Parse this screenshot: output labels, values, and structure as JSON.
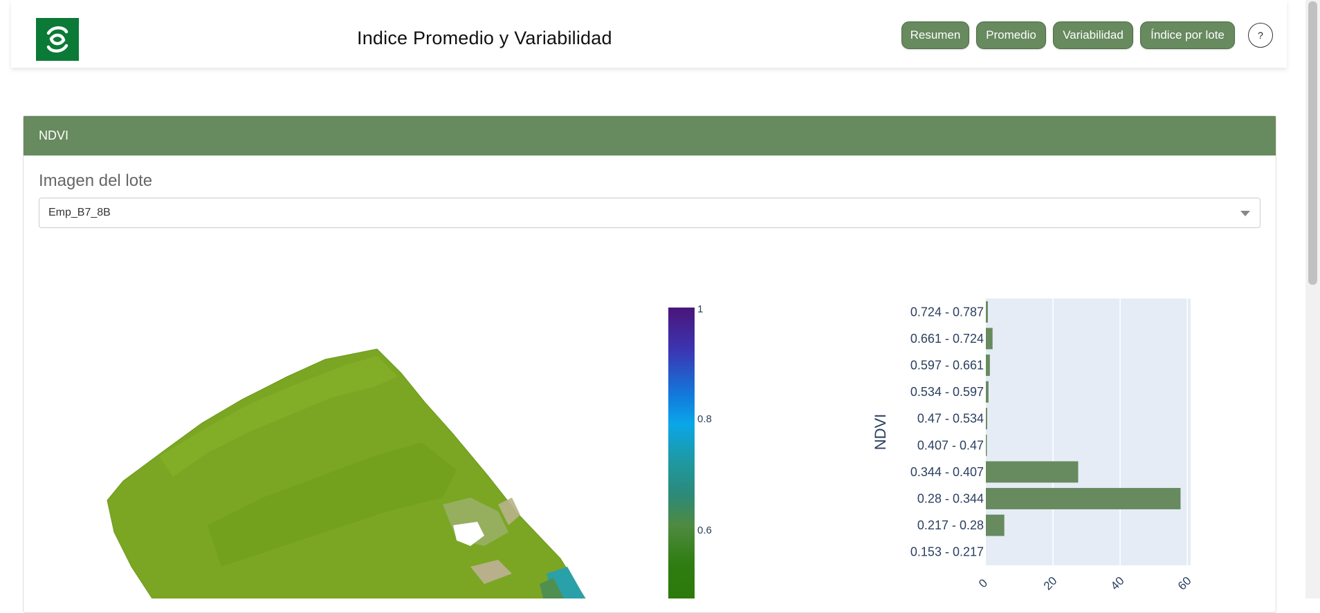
{
  "header": {
    "title": "Indice Promedio y Variabilidad",
    "nav": [
      "Resumen",
      "Promedio",
      "Variabilidad",
      "Índice por lote"
    ],
    "help_label": "?"
  },
  "card": {
    "title": "NDVI",
    "section_label": "Imagen del lote",
    "select_value": "Emp_B7_8B"
  },
  "colors": {
    "brand": "#678a5e",
    "logo_bg": "#0b7a36",
    "plot_bg": "#e5ecf6"
  },
  "colorbar": {
    "ticks": [
      "1",
      "0.8",
      "0.6"
    ]
  },
  "chart_data": {
    "type": "bar",
    "orientation": "horizontal",
    "ylabel": "NDVI",
    "categories": [
      "0.153 - 0.217",
      "0.217 - 0.28",
      "0.28 - 0.344",
      "0.344 - 0.407",
      "0.407 - 0.47",
      "0.47 - 0.534",
      "0.534 - 0.597",
      "0.597 - 0.661",
      "0.661 - 0.724",
      "0.724 - 0.787"
    ],
    "values": [
      0,
      5.5,
      58,
      27.5,
      0.3,
      0.4,
      0.8,
      1.2,
      2,
      0.6
    ],
    "xticks": [
      "0",
      "20",
      "40",
      "60"
    ],
    "xlim": [
      0,
      61
    ],
    "grid": true
  }
}
